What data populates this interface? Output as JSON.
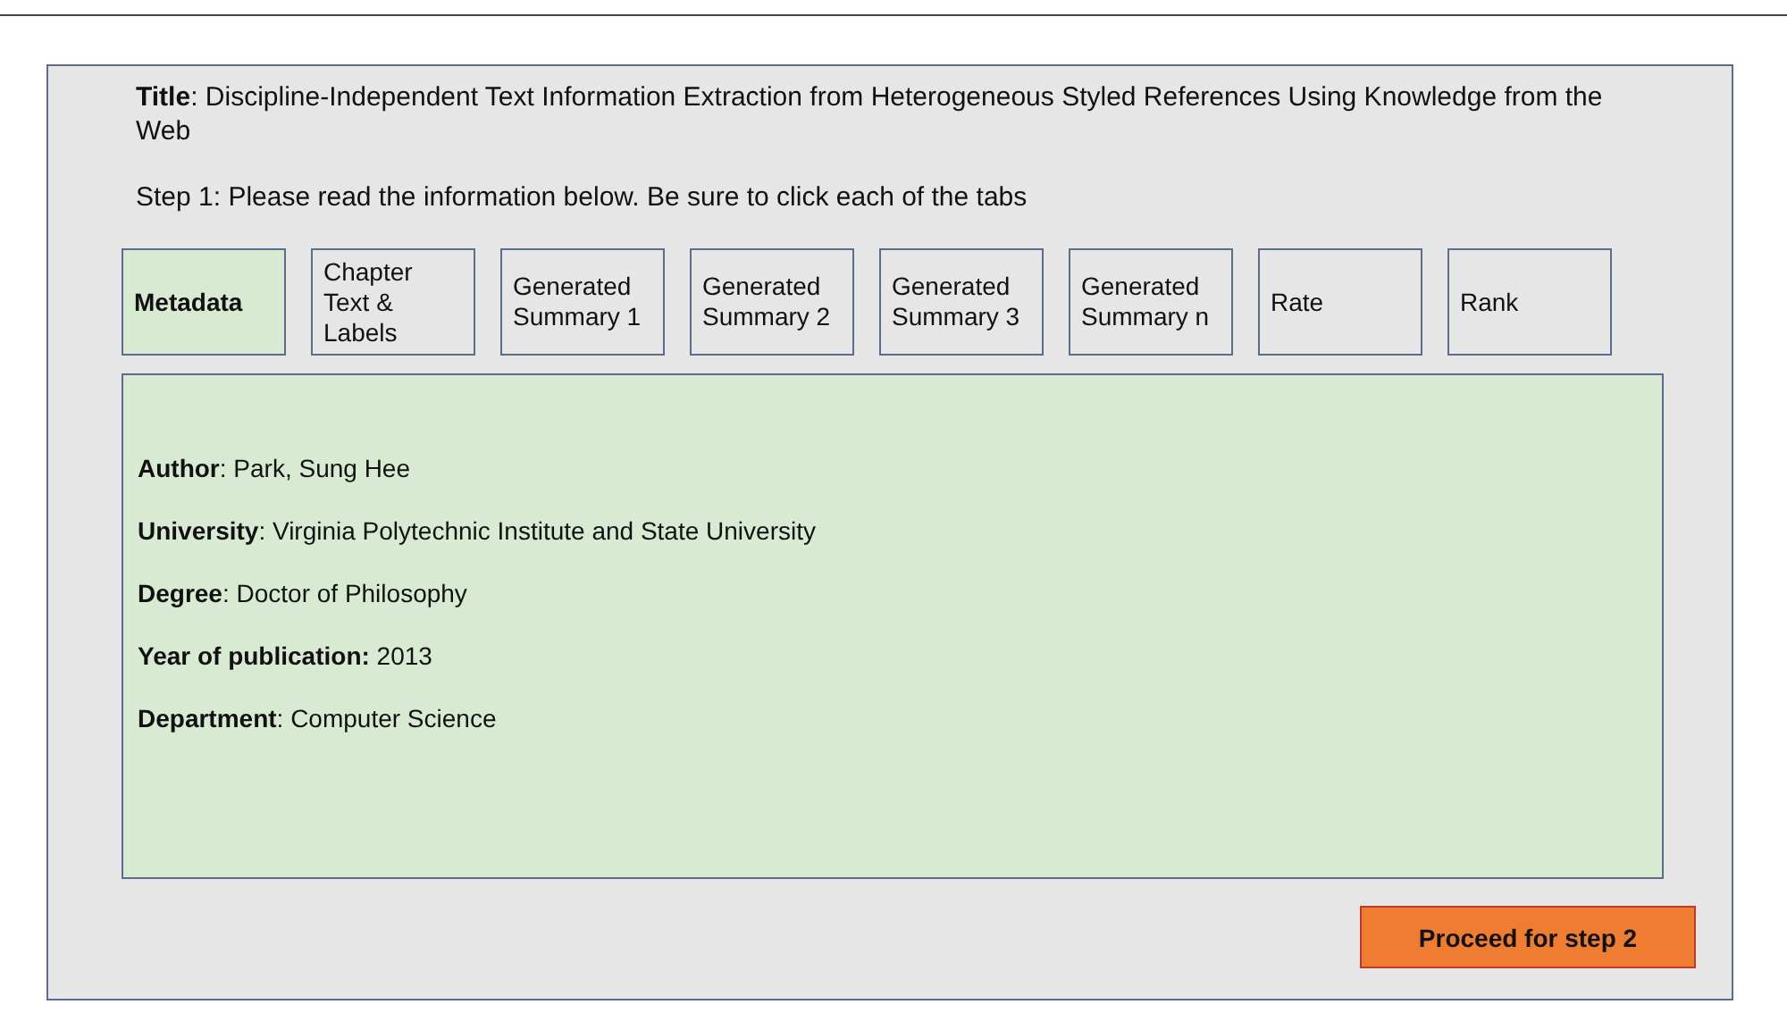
{
  "title": "**Title**: Discipline-Independent Text Information Extraction from Heterogeneous Styled References Using Knowledge from the Web",
  "instruction": "Step 1: Please read the information below. Be sure to click each of the tabs",
  "tabs": [
    {
      "label": "Metadata",
      "selected": true
    },
    {
      "label": "Chapter Text & Labels",
      "selected": false
    },
    {
      "label": "Generated Summary 1",
      "selected": false
    },
    {
      "label": "Generated Summary 2",
      "selected": false
    },
    {
      "label": "Generated Summary 3",
      "selected": false
    },
    {
      "label": "Generated Summary n",
      "selected": false
    },
    {
      "label": "Rate",
      "selected": false
    },
    {
      "label": "Rank",
      "selected": false
    }
  ],
  "metadata": [
    "**Author**: Park, Sung Hee",
    "**University**: Virginia Polytechnic Institute and State University",
    "**Degree**: Doctor of Philosophy",
    "**Year of publication:** 2013",
    "**Department**: Computer Science"
  ],
  "proceed_button": "Proceed for step 2"
}
